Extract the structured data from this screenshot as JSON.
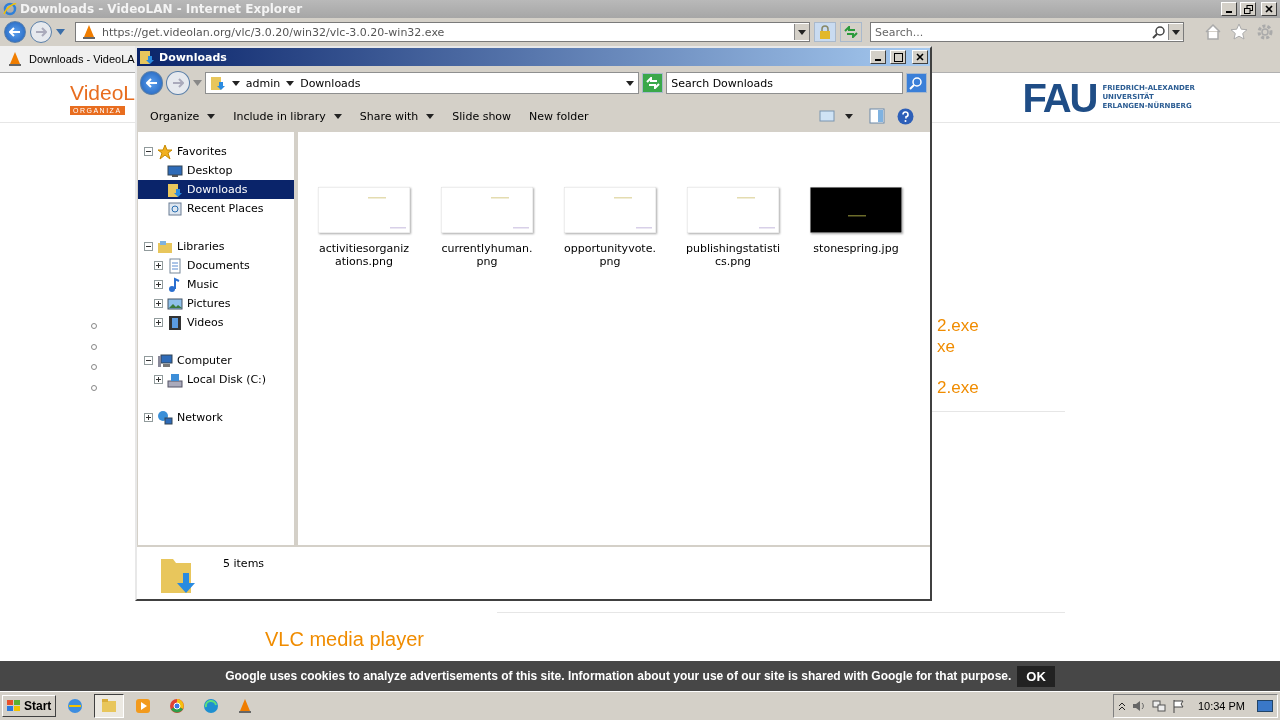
{
  "browser": {
    "title": "Downloads - VideoLAN - Internet Explorer",
    "address": "https://get.videolan.org/vlc/3.0.20/win32/vlc-3.0.20-win32.exe",
    "search": {
      "placeholder": "Search..."
    },
    "tabs": [
      {
        "label": "Downloads - VideoLA",
        "selected": true
      }
    ]
  },
  "page": {
    "logo_left": {
      "name": "VideoL",
      "tagline": "ORGANIZA"
    },
    "logo_right": {
      "mark": "FAU",
      "lines": [
        "FRIEDRICH-ALEXANDER",
        "UNIVERSITÄT",
        "ERLANGEN-NÜRNBERG"
      ]
    },
    "list": [
      {
        "kind": "link",
        "text": "2.exe"
      },
      {
        "kind": "link",
        "text": "xe"
      },
      {
        "kind": "blank"
      },
      {
        "kind": "link",
        "text": "2.exe"
      }
    ],
    "heading": "VLC media player",
    "cookie": {
      "text": "Google uses cookies to analyze advertisements of this site. Information about your use of our site is shared with Google for that purpose.",
      "button": "OK"
    }
  },
  "explorer": {
    "title": "Downloads",
    "breadcrumb": [
      "admin",
      "Downloads"
    ],
    "search": {
      "placeholder": "Search Downloads"
    },
    "toolbar": [
      {
        "label": "Organize",
        "menu": true
      },
      {
        "label": "Include in library",
        "menu": true
      },
      {
        "label": "Share with",
        "menu": true
      },
      {
        "label": "Slide show",
        "menu": false
      },
      {
        "label": "New folder",
        "menu": false
      }
    ],
    "tree": [
      {
        "label": "Favorites",
        "expanded": true,
        "selected": false,
        "children": [
          {
            "label": "Desktop",
            "selected": false
          },
          {
            "label": "Downloads",
            "selected": true
          },
          {
            "label": "Recent Places",
            "selected": false
          }
        ]
      },
      {
        "label": "Libraries",
        "expanded": true,
        "selected": false,
        "children": [
          {
            "label": "Documents",
            "expanded": false,
            "selected": false
          },
          {
            "label": "Music",
            "expanded": false,
            "selected": false
          },
          {
            "label": "Pictures",
            "expanded": false,
            "selected": false
          },
          {
            "label": "Videos",
            "expanded": false,
            "selected": false
          }
        ]
      },
      {
        "label": "Computer",
        "expanded": true,
        "selected": false,
        "children": [
          {
            "label": "Local Disk (C:)",
            "expanded": false,
            "selected": false
          }
        ]
      },
      {
        "label": "Network",
        "expanded": false,
        "selected": false
      }
    ],
    "files": [
      {
        "name": "activitiesorganizations.png"
      },
      {
        "name": "currentlyhuman.png"
      },
      {
        "name": "opportunityvote.png"
      },
      {
        "name": "publishingstatistics.png"
      },
      {
        "name": "stonespring.jpg"
      }
    ],
    "status": "5 items"
  },
  "taskbar": {
    "start": "Start",
    "apps": [
      {
        "kind": "globe",
        "selected": false
      },
      {
        "kind": "folder",
        "selected": true
      },
      {
        "kind": "player",
        "selected": false
      },
      {
        "kind": "ring",
        "selected": false
      },
      {
        "kind": "wave",
        "selected": false
      },
      {
        "kind": "cone",
        "selected": false
      }
    ],
    "clock": "10:34 PM"
  }
}
